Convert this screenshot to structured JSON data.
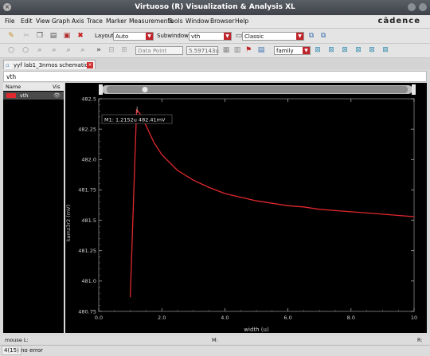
{
  "window": {
    "title": "Virtuoso (R) Visualization & Analysis XL"
  },
  "menu": {
    "items": [
      "File",
      "Edit",
      "View",
      "Graph",
      "Axis",
      "Trace",
      "Marker",
      "Measurements",
      "Tools",
      "Window",
      "Browser",
      "Help"
    ],
    "brand": "cādence"
  },
  "toolbar1": {
    "layout_label": "Layout",
    "layout_value": "Auto",
    "subwindows_label": "Subwindows",
    "subwindows_value": "vth",
    "style_value": "Classic"
  },
  "toolbar2": {
    "datapoint_placeholder": "Data Point",
    "datapoint_value": "5.597143u",
    "family_value": "family"
  },
  "tab": {
    "label": "yyf lab1_3nmos schematic"
  },
  "subwindow": {
    "title": "vth"
  },
  "trace_panel": {
    "col_name": "Name",
    "col_vis": "Vis",
    "traces": [
      {
        "name": "vth",
        "color": "#e0282e"
      }
    ]
  },
  "marker": {
    "label": "M1: 1.2152u 482.41mV"
  },
  "chart_data": {
    "type": "line",
    "xlabel": "width (u)",
    "ylabel": "kamz3r2 (mV)",
    "xlim": [
      0,
      10
    ],
    "ylim": [
      480.75,
      482.5
    ],
    "x_ticks": [
      "0.0",
      "2.0",
      "4.0",
      "6.0",
      "8.0",
      "10"
    ],
    "y_ticks": [
      "480.75",
      "481.0",
      "481.25",
      "481.5",
      "481.75",
      "482.0",
      "482.25",
      "482.5"
    ],
    "series": [
      {
        "color": "#e0282e",
        "x": [
          1.0,
          1.2,
          1.3,
          1.5,
          1.75,
          2.0,
          2.5,
          3.0,
          3.5,
          4.0,
          4.5,
          5.0,
          5.5,
          6.0,
          6.5,
          7.0,
          7.5,
          8.0,
          8.5,
          9.0,
          9.5,
          10.0
        ],
        "y": [
          480.87,
          482.41,
          482.38,
          482.28,
          482.14,
          482.04,
          481.91,
          481.83,
          481.77,
          481.72,
          481.69,
          481.66,
          481.64,
          481.62,
          481.61,
          481.59,
          481.58,
          481.57,
          481.56,
          481.55,
          481.54,
          481.53
        ]
      }
    ]
  },
  "status": {
    "mouse": "mouse L:",
    "middle": "M:",
    "right": "R:",
    "counter": "4(15)",
    "message": "no error"
  },
  "colors": {
    "plot_bg": "#000000",
    "accent_red": "#c0242a"
  }
}
